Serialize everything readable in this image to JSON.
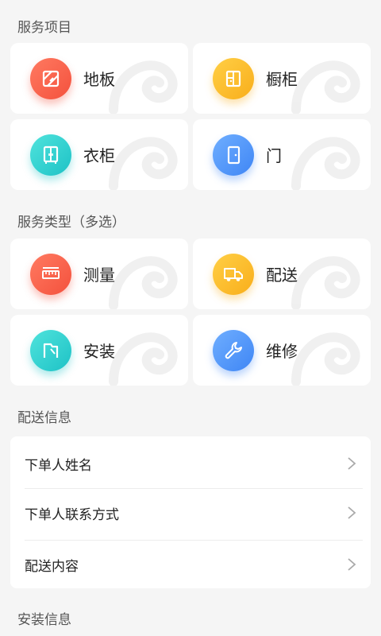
{
  "sections": {
    "service_items": "服务项目",
    "service_types": "服务类型（多选）",
    "delivery_info": "配送信息",
    "install_info": "安装信息"
  },
  "service_items": [
    {
      "label": "地板",
      "icon": "floor-icon",
      "color": "#f4513d"
    },
    {
      "label": "橱柜",
      "icon": "cabinet-icon",
      "color": "#f9ae1b"
    },
    {
      "label": "衣柜",
      "icon": "wardrobe-icon",
      "color": "#1ec2c6"
    },
    {
      "label": "门",
      "icon": "door-icon",
      "color": "#3f86f5"
    }
  ],
  "service_types": [
    {
      "label": "测量",
      "icon": "ruler-icon",
      "color": "#f4513d"
    },
    {
      "label": "配送",
      "icon": "truck-icon",
      "color": "#f9ae1b"
    },
    {
      "label": "安装",
      "icon": "install-icon",
      "color": "#1ec2c6"
    },
    {
      "label": "维修",
      "icon": "wrench-icon",
      "color": "#3f86f5"
    }
  ],
  "delivery_rows": [
    {
      "label": "下单人姓名",
      "icon": "chevron-right-icon"
    },
    {
      "label": "下单人联系方式",
      "icon": "chevron-right-icon"
    },
    {
      "label": "配送内容",
      "icon": "chevron-right-icon"
    }
  ]
}
